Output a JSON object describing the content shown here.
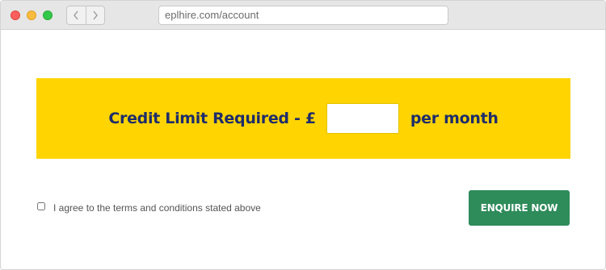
{
  "browser": {
    "url": "eplhire.com/account",
    "back_icon": "chevron-left-icon",
    "forward_icon": "chevron-right-icon",
    "window_controls": [
      "close",
      "minimize",
      "zoom"
    ]
  },
  "credit_form": {
    "label_prefix": "Credit Limit Required - £",
    "amount_value": "",
    "amount_placeholder": "",
    "label_suffix": "per month",
    "banner_color": "#ffd400",
    "text_color": "#1f2d6b"
  },
  "agreement": {
    "label": "I agree to the terms and conditions stated above",
    "checked": false
  },
  "actions": {
    "enquire_label": "ENQUIRE NOW",
    "enquire_color": "#2e8b5a"
  }
}
